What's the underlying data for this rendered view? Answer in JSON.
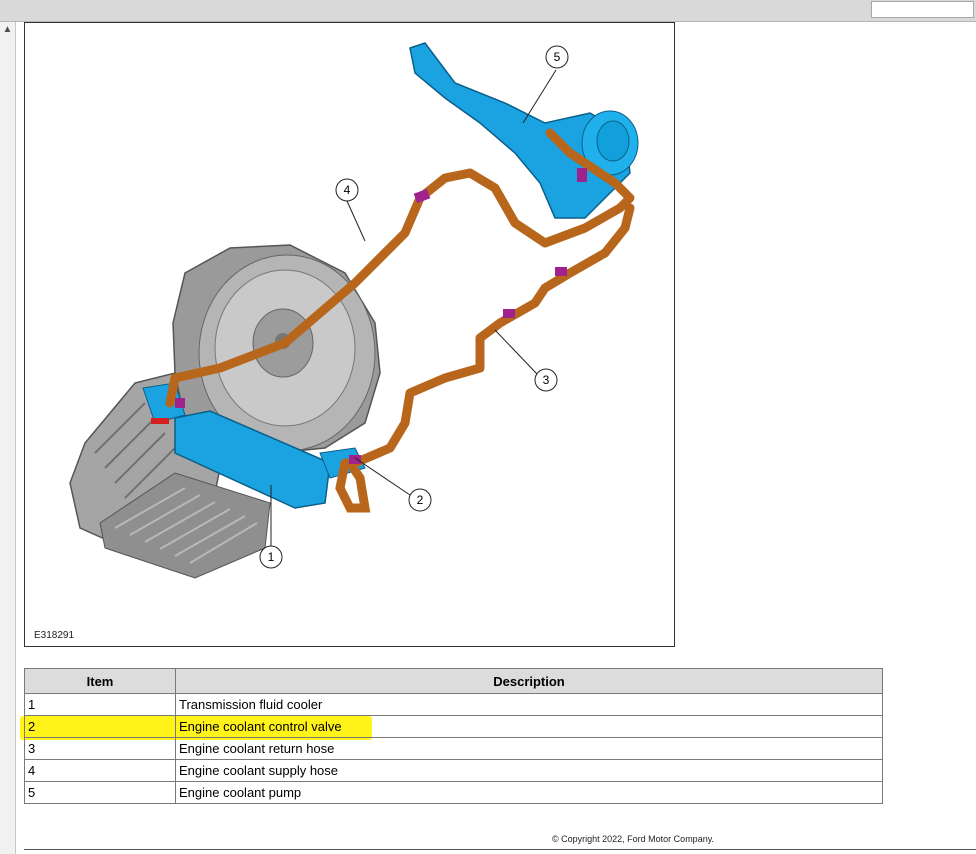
{
  "figure": {
    "id": "E318291",
    "callouts": [
      "1",
      "2",
      "3",
      "4",
      "5"
    ]
  },
  "table": {
    "headers": {
      "item": "Item",
      "description": "Description"
    },
    "rows": [
      {
        "item": "1",
        "description": "Transmission fluid cooler",
        "highlighted": false
      },
      {
        "item": "2",
        "description": "Engine coolant control valve",
        "highlighted": true
      },
      {
        "item": "3",
        "description": "Engine coolant return hose",
        "highlighted": false
      },
      {
        "item": "4",
        "description": "Engine coolant supply hose",
        "highlighted": false
      },
      {
        "item": "5",
        "description": "Engine coolant pump",
        "highlighted": false
      }
    ]
  },
  "footer": {
    "copyright": "© Copyright 2022, Ford Motor Company."
  },
  "colors": {
    "highlight": "#fff200",
    "hose": "#b8661c",
    "component": "#1aa3e0",
    "clamp": "#a0228c"
  }
}
